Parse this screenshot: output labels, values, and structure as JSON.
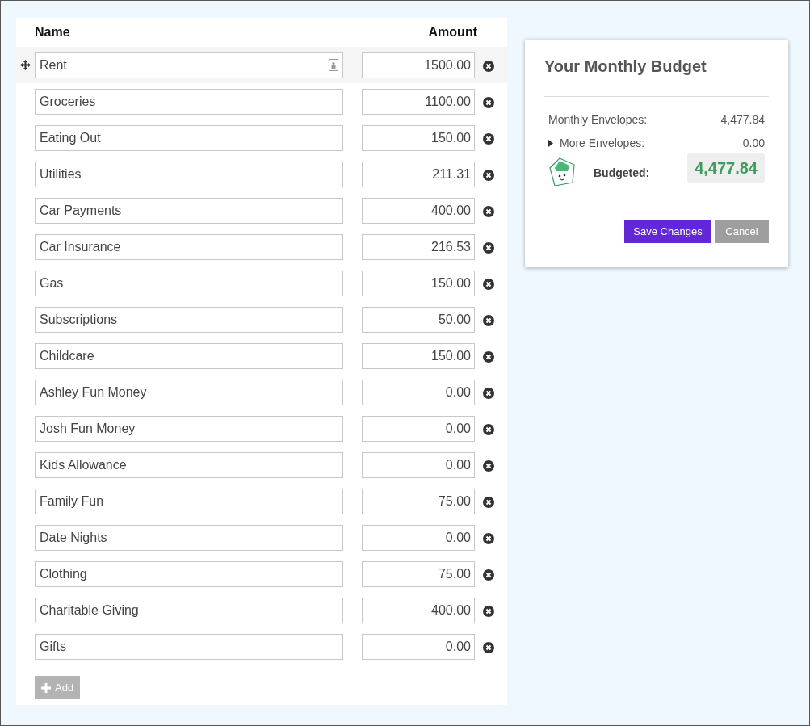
{
  "columns": {
    "name": "Name",
    "amount": "Amount"
  },
  "envelopes": [
    {
      "name": "Rent",
      "amount": "1500.00",
      "hovered": true
    },
    {
      "name": "Groceries",
      "amount": "1100.00",
      "hovered": false
    },
    {
      "name": "Eating Out",
      "amount": "150.00",
      "hovered": false
    },
    {
      "name": "Utilities",
      "amount": "211.31",
      "hovered": false
    },
    {
      "name": "Car Payments",
      "amount": "400.00",
      "hovered": false
    },
    {
      "name": "Car Insurance",
      "amount": "216.53",
      "hovered": false
    },
    {
      "name": "Gas",
      "amount": "150.00",
      "hovered": false
    },
    {
      "name": "Subscriptions",
      "amount": "50.00",
      "hovered": false
    },
    {
      "name": "Childcare",
      "amount": "150.00",
      "hovered": false
    },
    {
      "name": "Ashley Fun Money",
      "amount": "0.00",
      "hovered": false
    },
    {
      "name": "Josh Fun Money",
      "amount": "0.00",
      "hovered": false
    },
    {
      "name": "Kids Allowance",
      "amount": "0.00",
      "hovered": false
    },
    {
      "name": "Family Fun",
      "amount": "75.00",
      "hovered": false
    },
    {
      "name": "Date Nights",
      "amount": "0.00",
      "hovered": false
    },
    {
      "name": "Clothing",
      "amount": "75.00",
      "hovered": false
    },
    {
      "name": "Charitable Giving",
      "amount": "400.00",
      "hovered": false
    },
    {
      "name": "Gifts",
      "amount": "0.00",
      "hovered": false
    }
  ],
  "add_button": "Add",
  "budget": {
    "title": "Your Monthly Budget",
    "monthly_label": "Monthly Envelopes:",
    "monthly_value": "4,477.84",
    "more_label": "More Envelopes:",
    "more_value": "0.00",
    "more_expanded": false,
    "budgeted_label": "Budgeted:",
    "budgeted_value": "4,477.84",
    "buttons": [
      "Save Changes",
      "Cancel"
    ]
  }
}
